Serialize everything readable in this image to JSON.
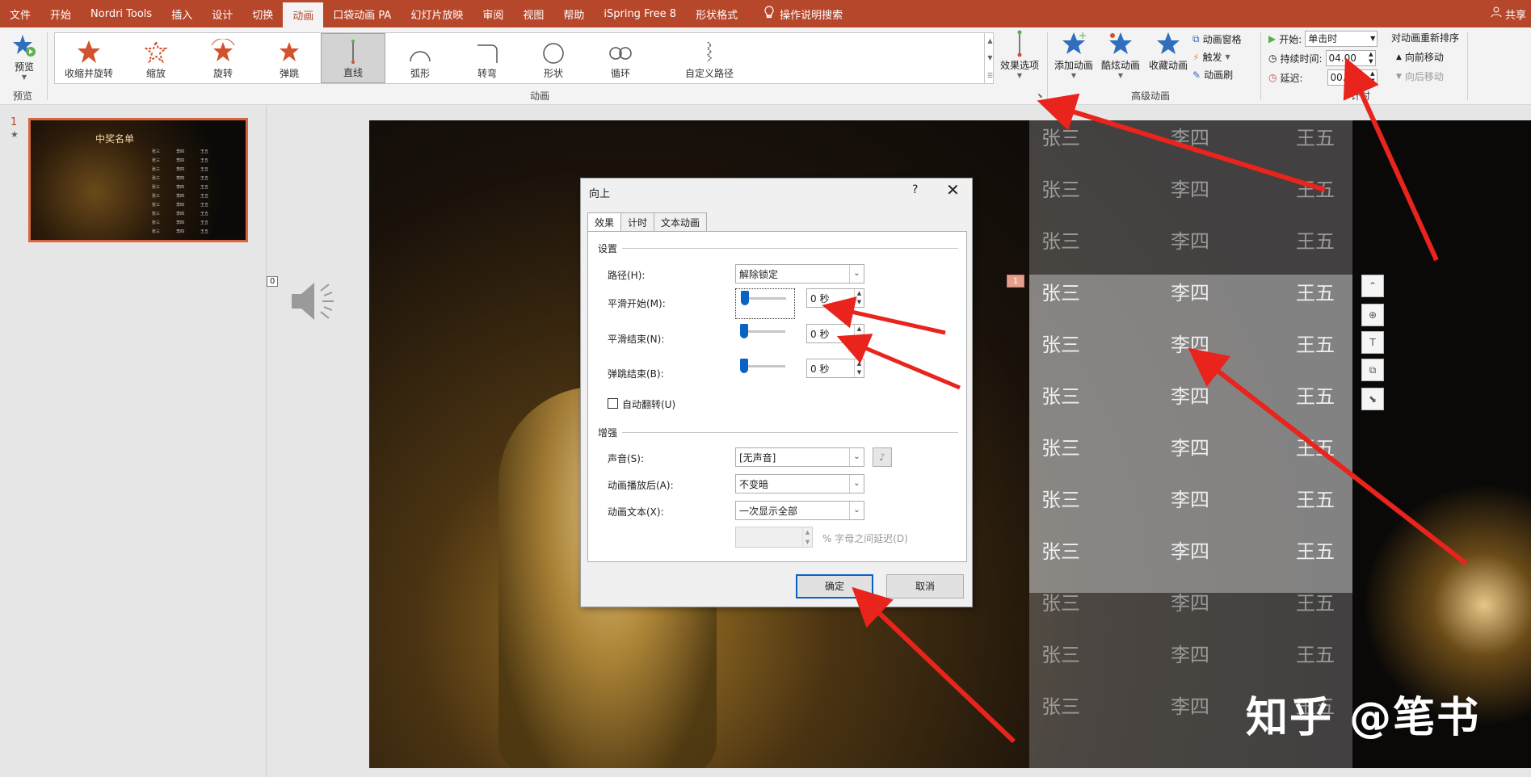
{
  "tabs": [
    "文件",
    "开始",
    "Nordri Tools",
    "插入",
    "设计",
    "切换",
    "动画",
    "口袋动画 PA",
    "幻灯片放映",
    "审阅",
    "视图",
    "帮助",
    "iSpring Free 8",
    "形状格式"
  ],
  "active_tab": "动画",
  "search_label": "操作说明搜索",
  "share_label": "共享",
  "ribbon": {
    "preview_label": "预览",
    "preview_group": "预览",
    "gallery_items": [
      "收缩并旋转",
      "缩放",
      "旋转",
      "弹跳",
      "直线",
      "弧形",
      "转弯",
      "形状",
      "循环",
      "自定义路径"
    ],
    "selected_gallery_item": "直线",
    "effect_options": "效果选项",
    "animation_group": "动画",
    "add_animation": "添加动画",
    "cool_animation": "酷炫动画",
    "fav_animation": "收藏动画",
    "anim_pane": "动画窗格",
    "trigger": "触发",
    "anim_painter": "动画刷",
    "advanced_group": "高级动画",
    "start_label": "开始:",
    "start_value": "单击时",
    "duration_label": "持续时间:",
    "duration_value": "04.00",
    "delay_label": "延迟:",
    "delay_value": "00.00",
    "timing_group": "计时",
    "reorder_title": "对动画重新排序",
    "move_earlier": "向前移动",
    "move_later": "向后移动"
  },
  "slides": {
    "number": "1",
    "star": "★",
    "thumb_title": "中奖名单"
  },
  "slide": {
    "sound_label": "0",
    "anim_tag": "1",
    "names": [
      "张三",
      "李四",
      "王五"
    ],
    "watermark": "知乎 @笔书"
  },
  "dialog": {
    "title": "向上",
    "help": "?",
    "close": "✕",
    "tabs": [
      "效果",
      "计时",
      "文本动画"
    ],
    "settings_section": "设置",
    "path_label": "路径(H):",
    "path_value": "解除锁定",
    "smooth_start_label": "平滑开始(M):",
    "smooth_start_value": "0 秒",
    "smooth_end_label": "平滑结束(N):",
    "smooth_end_value": "0 秒",
    "bounce_end_label": "弹跳结束(B):",
    "bounce_end_value": "0 秒",
    "auto_reverse_label": "自动翻转(U)",
    "enhance_section": "增强",
    "sound_label": "声音(S):",
    "sound_value": "[无声音]",
    "after_anim_label": "动画播放后(A):",
    "after_anim_value": "不变暗",
    "anim_text_label": "动画文本(X):",
    "anim_text_value": "一次显示全部",
    "letter_delay_label": "% 字母之间延迟(D)",
    "ok": "确定",
    "cancel": "取消"
  }
}
